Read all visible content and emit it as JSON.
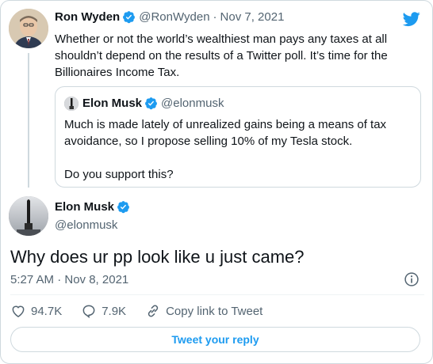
{
  "colors": {
    "accent": "#1d9bf0",
    "text": "#0f1419",
    "muted": "#536471",
    "border": "#cfd9de"
  },
  "parent_tweet": {
    "author_name": "Ron Wyden",
    "handle": "@RonWyden",
    "separator": "·",
    "date": "Nov 7, 2021",
    "text": "Whether or not the world’s wealthiest man pays any taxes at all shouldn’t depend on the results of a Twitter poll. It’s time for the Billionaires Income Tax."
  },
  "quoted_tweet": {
    "author_name": "Elon Musk",
    "handle": "@elonmusk",
    "text": "Much is made lately of unrealized gains being a means of tax avoidance, so I propose selling 10% of my Tesla stock.",
    "text2": "Do you support this?"
  },
  "main_tweet": {
    "author_name": "Elon Musk",
    "handle": "@elonmusk",
    "text": "Why does ur pp look like u just came?",
    "timestamp": "5:27 AM · Nov 8, 2021"
  },
  "actions": {
    "likes": "94.7K",
    "replies": "7.9K",
    "copy_link": "Copy link to Tweet"
  },
  "reply_button": "Tweet your reply",
  "icons": [
    "twitter-bird-icon",
    "verified-badge-icon",
    "info-icon",
    "heart-icon",
    "reply-bubble-icon",
    "link-icon"
  ]
}
